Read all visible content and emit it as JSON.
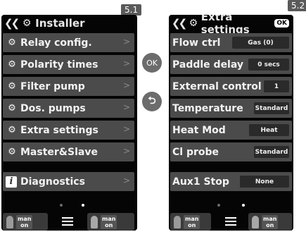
{
  "labels": {
    "left": "5.1",
    "right": "5.2"
  },
  "colors": {
    "screen_bg": "#050505",
    "row_bg": "#4b4b4b",
    "value_box_bg": "#2a2a2a",
    "nav_button_bg": "#6c6c6c"
  },
  "nav_buttons": {
    "ok": "OK",
    "back_glyph": "⮌"
  },
  "installer": {
    "title": "Installer",
    "back_glyph": "❮❮",
    "items": [
      {
        "label": "Relay config.",
        "icon": "gears-icon"
      },
      {
        "label": "Polarity times",
        "icon": "gears-icon"
      },
      {
        "label": "Filter pump",
        "icon": "gears-icon"
      },
      {
        "label": "Dos. pumps",
        "icon": "gears-icon"
      },
      {
        "label": "Extra settings",
        "icon": "gears-icon"
      },
      {
        "label": "Master&Slave",
        "icon": "gears-icon"
      },
      {
        "label": "Diagnostics",
        "icon": "info-icon"
      }
    ],
    "footer": {
      "man": "man",
      "on": "on"
    }
  },
  "extra": {
    "title": "Extra settings",
    "ok_badge": "OK",
    "items": [
      {
        "label": "Flow ctrl",
        "value": "Gas (0)"
      },
      {
        "label": "Paddle delay",
        "value": "0 secs"
      },
      {
        "label": "External control",
        "value": "1"
      },
      {
        "label": "Temperature",
        "value": "Standard"
      },
      {
        "label": "Heat Mod",
        "value": "Heat"
      },
      {
        "label": "Cl probe",
        "value": "Standard"
      },
      {
        "label": "Aux1 Stop",
        "value": "None"
      }
    ],
    "footer": {
      "man": "man",
      "on": "on"
    }
  }
}
